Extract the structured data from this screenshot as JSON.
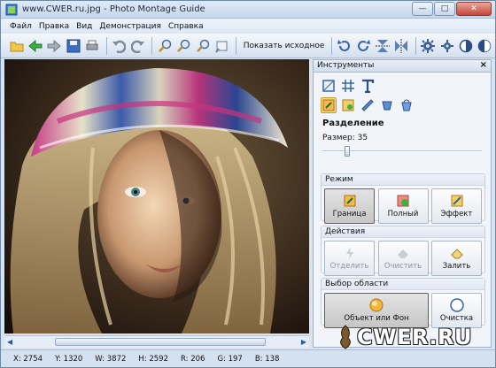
{
  "window": {
    "title": "www.CWER.ru.jpg - Photo Montage Guide",
    "minimize": "—",
    "maximize": "□",
    "close": "✕"
  },
  "menu": [
    "Файл",
    "Правка",
    "Вид",
    "Демонстрация",
    "Справка"
  ],
  "toolbar": {
    "show_original": "Показать исходное",
    "icons": [
      "open-icon",
      "back-icon",
      "forward-icon",
      "save-icon",
      "print-icon",
      "undo-icon",
      "redo-icon",
      "zoom-in-icon",
      "zoom-out-icon",
      "zoom-fit-icon",
      "zoom-actual-icon",
      "rotate-left-icon",
      "rotate-right-icon",
      "flip-vertical-icon",
      "flip-horizontal-icon",
      "settings-icon",
      "gear-icon",
      "contrast-icon",
      "invert-icon"
    ]
  },
  "panel": {
    "title": "Инструменты",
    "close": "×",
    "section": "Разделение",
    "size_label": "Размер: 35",
    "size_value": 35,
    "mode": {
      "title": "Режим",
      "buttons": [
        "Граница",
        "Полный",
        "Эффект"
      ]
    },
    "actions": {
      "title": "Действия",
      "buttons": [
        "Отделить",
        "Очистить",
        "Залить"
      ]
    },
    "selection": {
      "title": "Выбор области",
      "buttons": [
        "Объект или Фон",
        "Очистка"
      ]
    }
  },
  "status": {
    "x": "X: 2754",
    "y": "Y: 1320",
    "w": "W: 3872",
    "h": "H: 2592",
    "r": "R: 206",
    "g": "G: 197",
    "b": "B: 138"
  },
  "watermark": "CWER.RU",
  "colors": {
    "accent": "#f6dc86",
    "titlebar": "#c5d6ec",
    "panel": "#f1f4f9"
  }
}
